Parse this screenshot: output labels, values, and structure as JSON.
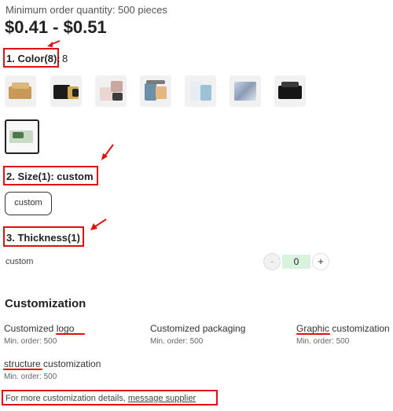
{
  "header": {
    "moq": "Minimum order quantity: 500 pieces",
    "price": "$0.41 - $0.51"
  },
  "color_section": {
    "title": "1. Color(8):",
    "count": "8",
    "swatches": [
      {
        "icon": "kraft-box-thumbnail"
      },
      {
        "icon": "black-gold-box-thumbnail"
      },
      {
        "icon": "pink-gift-box-thumbnail"
      },
      {
        "icon": "printed-box-thumbnail"
      },
      {
        "icon": "white-box-thumbnail"
      },
      {
        "icon": "holographic-box-thumbnail"
      },
      {
        "icon": "black-box-thumbnail"
      },
      {
        "icon": "green-box-thumbnail"
      }
    ]
  },
  "size_section": {
    "title": "2. Size(1):  custom",
    "option": "custom"
  },
  "thickness_section": {
    "title": "3. Thickness(1)",
    "row_label": "custom",
    "minus": "-",
    "quantity": "0",
    "plus": "+"
  },
  "customization": {
    "heading": "Customization",
    "items": [
      {
        "title": "Customized logo",
        "min": "Min. order: 500"
      },
      {
        "title": "Customized packaging",
        "min": "Min. order: 500"
      },
      {
        "title": "Graphic customization",
        "min": "Min. order: 500"
      },
      {
        "title": "structure customization",
        "min": "Min. order: 500"
      }
    ],
    "more_text": "For more customization details, ",
    "more_link": "message supplier"
  },
  "colors": {
    "annotation_red": "#e01010",
    "stepper_value_bg": "#d9f2dd"
  }
}
